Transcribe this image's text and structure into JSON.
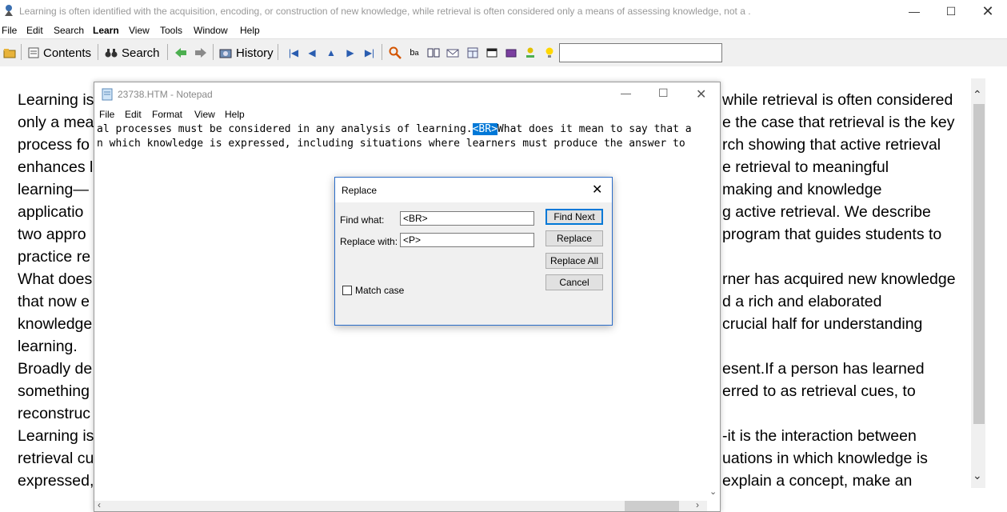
{
  "window": {
    "title": "Learning is often identified with the acquisition, encoding, or construction of new knowledge, while retrieval is often considered only a means of assessing knowledge, not a ."
  },
  "menu": [
    "File",
    "Edit",
    "Search",
    "Learn",
    "View",
    "Tools",
    "Window",
    "Help"
  ],
  "toolbar": {
    "contents_label": "Contents",
    "search_label": "Search",
    "history_label": "History",
    "search_value": ""
  },
  "content_lines": [
    {
      "left": "Learning is",
      "right": "while retrieval is often considered"
    },
    {
      "left": "only a mea",
      "right": "e the case that retrieval is the key"
    },
    {
      "left": "process fo",
      "right": "rch showing that active retrieval"
    },
    {
      "left": "enhances l",
      "right": "e retrieval to meaningful"
    },
    {
      "left": "learning—",
      "right": "making and knowledge"
    },
    {
      "left": "applicatio",
      "right": "g active retrieval. We describe"
    },
    {
      "left": "two appro",
      "right": "program that guides students to"
    },
    {
      "left": "practice re",
      "right": ""
    },
    {
      "left": "What does",
      "right": "rner has acquired new knowledge"
    },
    {
      "left": "that now e",
      "right": "d a rich and elaborated"
    },
    {
      "left": "knowledge",
      "right": "crucial half for understanding"
    },
    {
      "left": "learning.",
      "right": ""
    },
    {
      "left": "Broadly de",
      "right": "esent.If a person has learned"
    },
    {
      "left": "something",
      "right": "erred to as retrieval cues, to"
    },
    {
      "left": "reconstruc",
      "right": ""
    },
    {
      "left": "Learning is",
      "right": "-it is the interaction between"
    },
    {
      "left": "retrieval cu",
      "right": "uations in which knowledge is"
    },
    {
      "left": "expressed,",
      "right": "explain a concept, make an"
    }
  ],
  "notepad": {
    "title": "23738.HTM - Notepad",
    "menu": [
      "File",
      "Edit",
      "Format",
      "View",
      "Help"
    ],
    "line1_before": "al processes must be considered in any analysis of learning.",
    "line1_selected": "<BR>",
    "line1_after": "What does it mean to say that a",
    "line2": "n which knowledge is expressed, including situations where learners must produce the answer to"
  },
  "replace_dialog": {
    "title": "Replace",
    "find_label": "Find what:",
    "find_value": "<BR>",
    "replace_label": "Replace with:",
    "replace_value": "<P>",
    "match_case_label": "Match case",
    "match_case_checked": false,
    "buttons": {
      "find_next": "Find Next",
      "replace": "Replace",
      "replace_all": "Replace All",
      "cancel": "Cancel"
    }
  }
}
